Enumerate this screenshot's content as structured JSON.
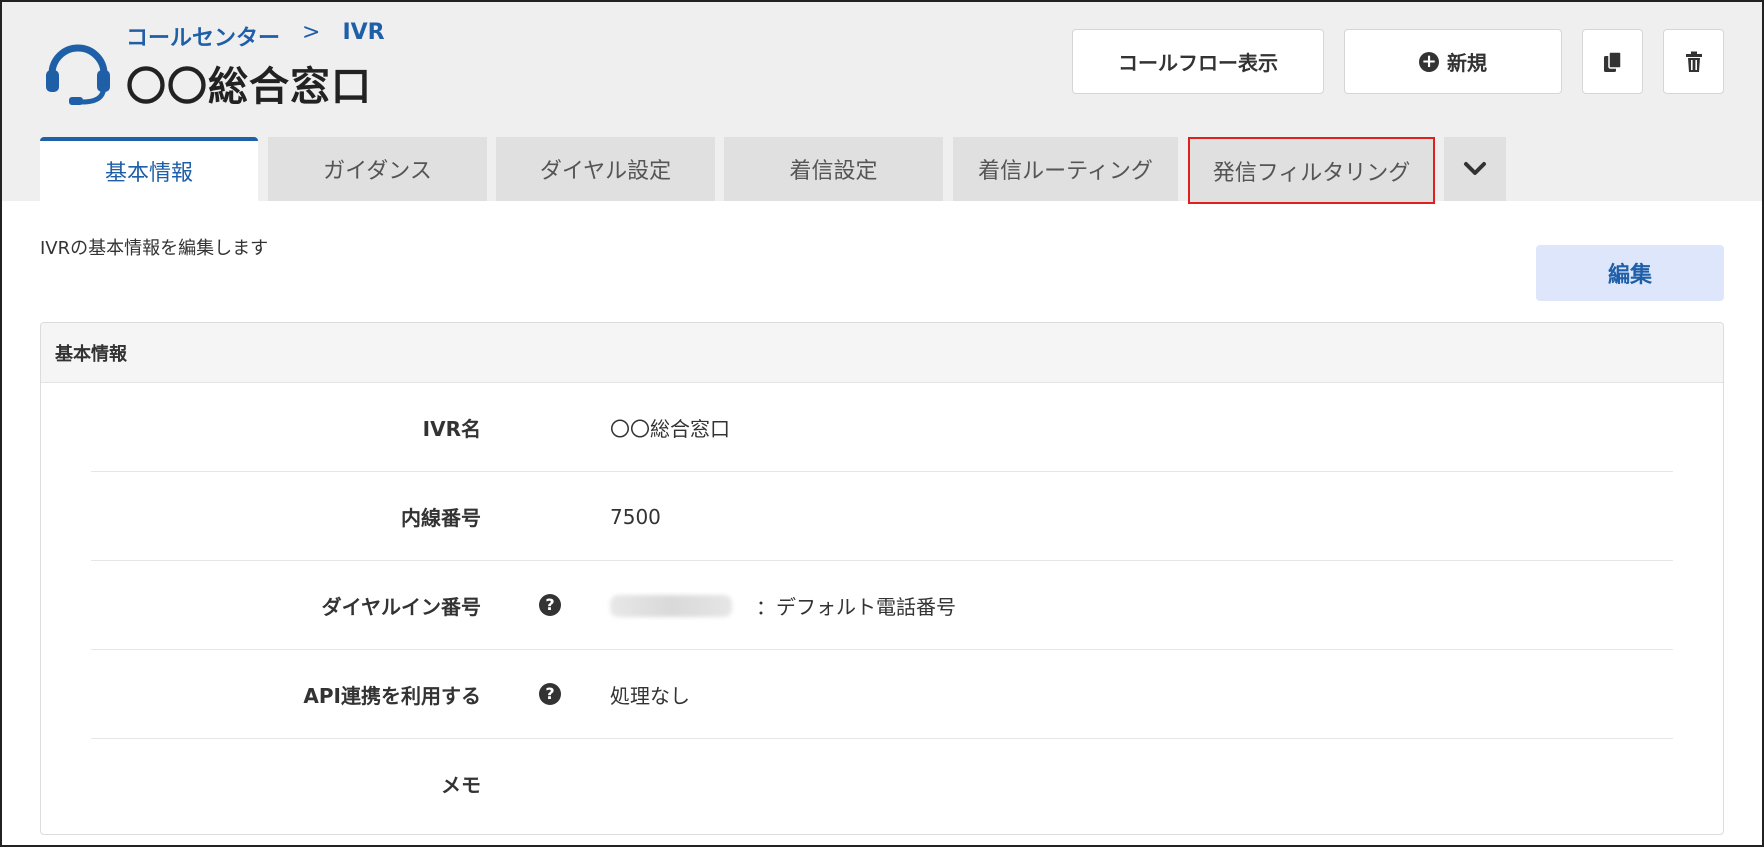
{
  "header": {
    "breadcrumb": [
      "コールセンター",
      "IVR"
    ],
    "breadcrumb_separator": ">",
    "title": "〇〇総合窓口",
    "headset_icon": "headset-icon",
    "accent_color": "#1f5fa8"
  },
  "toolbar": {
    "callflow_label": "コールフロー表示",
    "new_label": "新規",
    "new_icon": "plus-circle-icon",
    "copy_icon": "copy-icon",
    "delete_icon": "trash-icon"
  },
  "tabs": [
    {
      "label": "基本情報",
      "active": true
    },
    {
      "label": "ガイダンス",
      "active": false
    },
    {
      "label": "ダイヤル設定",
      "active": false
    },
    {
      "label": "着信設定",
      "active": false
    },
    {
      "label": "着信ルーティング",
      "active": false
    },
    {
      "label": "発信フィルタリング",
      "active": false,
      "highlighted": true
    }
  ],
  "tabs_more_icon": "chevron-down-icon",
  "main": {
    "description": "IVRの基本情報を編集します",
    "edit_label": "編集"
  },
  "panel": {
    "title": "基本情報",
    "rows": [
      {
        "label": "IVR名",
        "value": "〇〇総合窓口",
        "help": false
      },
      {
        "label": "内線番号",
        "value": "7500",
        "help": false
      },
      {
        "label": "ダイヤルイン番号",
        "value": "：デフォルト電話番号",
        "help": true
      },
      {
        "label": "API連携を利用する",
        "value": "処理なし",
        "help": true
      },
      {
        "label": "メモ",
        "value": "",
        "help": false
      }
    ],
    "help_glyph": "?"
  }
}
